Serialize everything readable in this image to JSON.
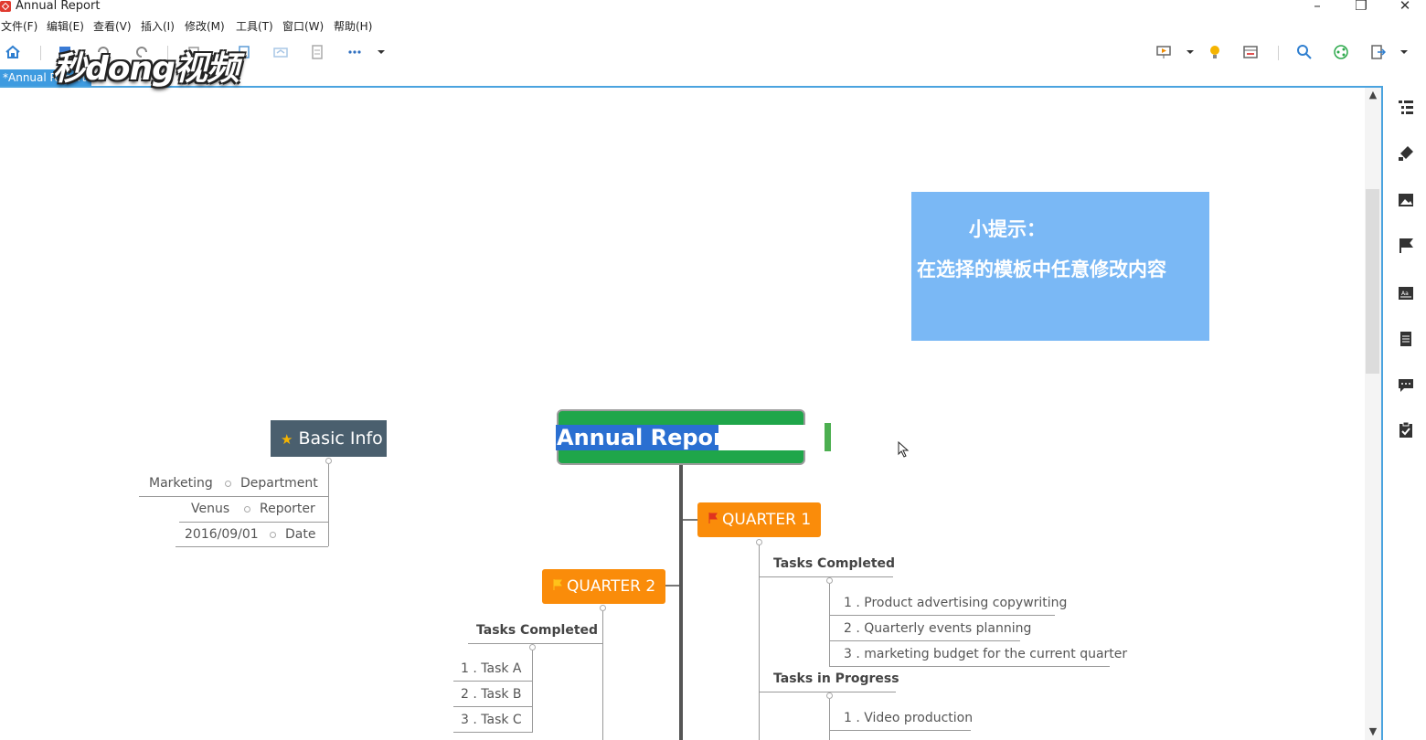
{
  "window": {
    "title": "Annual Report",
    "minimize": "–",
    "restore": "❐",
    "close": "✕"
  },
  "menu": [
    "文件(F)",
    "编辑(E)",
    "查看(V)",
    "插入(I)",
    "修改(M)",
    "工具(T)",
    "窗口(W)",
    "帮助(H)"
  ],
  "tab": {
    "label": "*Annual Report"
  },
  "watermark": "秒dong视频",
  "tip": {
    "title": "小提示：",
    "body": "在选择的模板中任意修改内容"
  },
  "central_topic": "Annual Report",
  "basic_info": {
    "title": "Basic Info",
    "rows": [
      {
        "value": "Marketing",
        "label": "Department"
      },
      {
        "value": "Venus",
        "label": "Reporter"
      },
      {
        "value": "2016/09/01",
        "label": "Date"
      }
    ]
  },
  "quarter1": {
    "title": "QUARTER 1",
    "completed_heading": "Tasks Completed",
    "completed": [
      "1 . Product advertising copywriting",
      "2 . Quarterly events planning",
      "3 . marketing budget for the current quarter"
    ],
    "progress_heading": "Tasks in Progress",
    "progress": [
      "1 . Video production"
    ]
  },
  "quarter2": {
    "title": "QUARTER 2",
    "completed_heading": "Tasks Completed",
    "completed": [
      "1 . Task A",
      "2 . Task B",
      "3 . Task C"
    ]
  },
  "colors": {
    "central": "#1fa64a",
    "quarter": "#fa8c0a",
    "basic_info": "#4a5f6e",
    "tip": "#7ab8f5",
    "selection": "#2a6fd1",
    "accent": "#3e9be0"
  },
  "toolbar_icons": [
    "home-icon",
    "save-icon",
    "undo-icon",
    "redo-icon",
    "copy-icon",
    "paste-icon",
    "share-icon",
    "outline-icon",
    "more-icon",
    "dropdown-icon",
    "presentation-icon",
    "lightbulb-icon",
    "layout-icon",
    "search-icon",
    "share-circle-icon",
    "export-icon"
  ],
  "panel_icons": [
    "outline-panel-icon",
    "format-panel-icon",
    "image-panel-icon",
    "marker-panel-icon",
    "style-panel-icon",
    "notes-panel-icon",
    "comment-panel-icon",
    "task-panel-icon"
  ]
}
